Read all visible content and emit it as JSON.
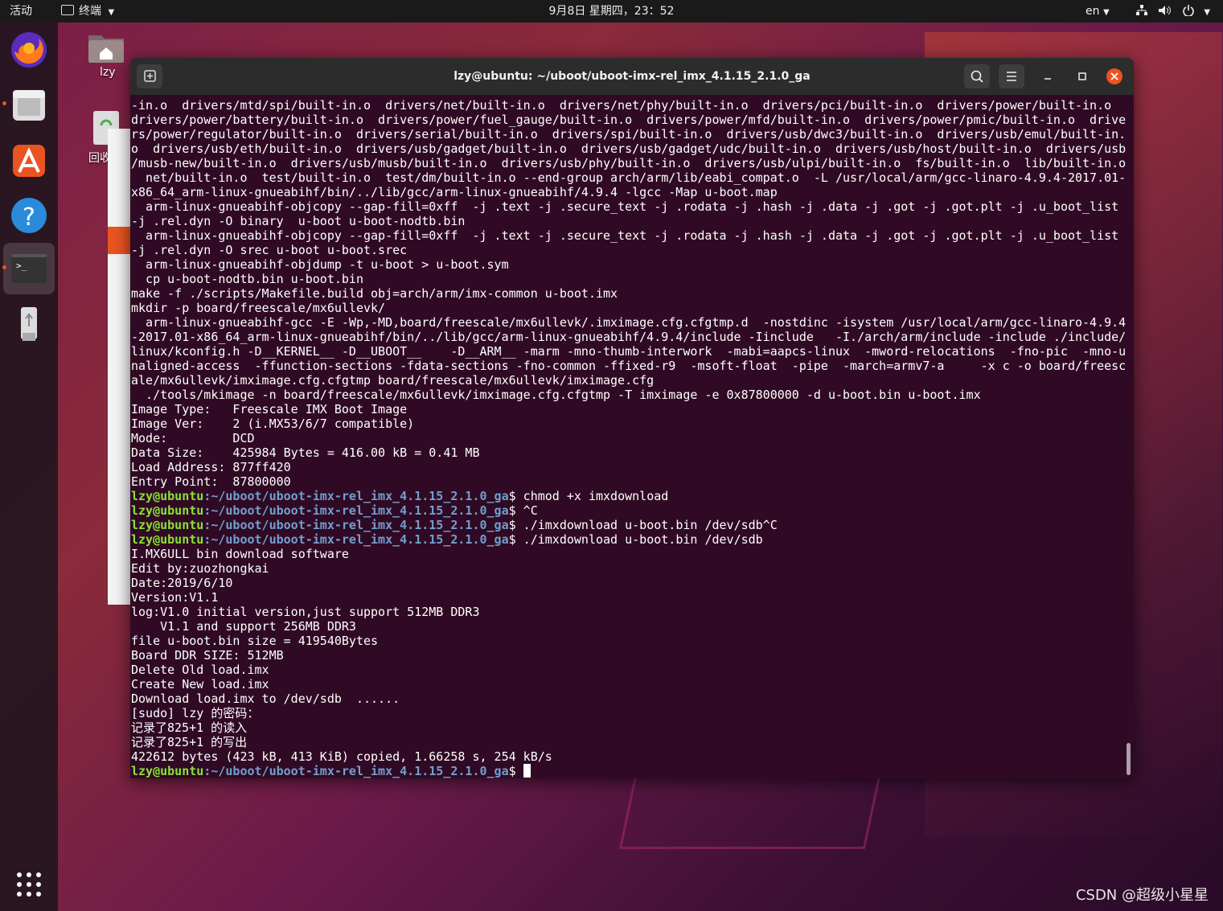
{
  "topbar": {
    "activities": "活动",
    "app_menu": "终端",
    "clock": "9月8日 星期四，23：52",
    "lang": "en"
  },
  "desktop": {
    "home_label": "lzy",
    "trash_label": "回收"
  },
  "terminal": {
    "title": "lzy@ubuntu: ~/uboot/uboot-imx-rel_imx_4.1.15_2.1.0_ga",
    "prompt_user": "lzy@ubuntu",
    "prompt_path": ":~/uboot/uboot-imx-rel_imx_4.1.15_2.1.0_ga",
    "lines_top": [
      "-in.o  drivers/mtd/spi/built-in.o  drivers/net/built-in.o  drivers/net/phy/built-in.o  drivers/pci/built-in.o  drivers/power/built-in.o",
      "drivers/power/battery/built-in.o  drivers/power/fuel_gauge/built-in.o  drivers/power/mfd/built-in.o  drivers/power/pmic/built-in.o  drive",
      "rs/power/regulator/built-in.o  drivers/serial/built-in.o  drivers/spi/built-in.o  drivers/usb/dwc3/built-in.o  drivers/usb/emul/built-in.",
      "o  drivers/usb/eth/built-in.o  drivers/usb/gadget/built-in.o  drivers/usb/gadget/udc/built-in.o  drivers/usb/host/built-in.o  drivers/usb",
      "/musb-new/built-in.o  drivers/usb/musb/built-in.o  drivers/usb/phy/built-in.o  drivers/usb/ulpi/built-in.o  fs/built-in.o  lib/built-in.o",
      "  net/built-in.o  test/built-in.o  test/dm/built-in.o --end-group arch/arm/lib/eabi_compat.o  -L /usr/local/arm/gcc-linaro-4.9.4-2017.01-",
      "x86_64_arm-linux-gnueabihf/bin/../lib/gcc/arm-linux-gnueabihf/4.9.4 -lgcc -Map u-boot.map",
      "  arm-linux-gnueabihf-objcopy --gap-fill=0xff  -j .text -j .secure_text -j .rodata -j .hash -j .data -j .got -j .got.plt -j .u_boot_list",
      "-j .rel.dyn -O binary  u-boot u-boot-nodtb.bin",
      "  arm-linux-gnueabihf-objcopy --gap-fill=0xff  -j .text -j .secure_text -j .rodata -j .hash -j .data -j .got -j .got.plt -j .u_boot_list",
      "-j .rel.dyn -O srec u-boot u-boot.srec",
      "  arm-linux-gnueabihf-objdump -t u-boot > u-boot.sym",
      "  cp u-boot-nodtb.bin u-boot.bin",
      "make -f ./scripts/Makefile.build obj=arch/arm/imx-common u-boot.imx",
      "mkdir -p board/freescale/mx6ullevk/",
      "  arm-linux-gnueabihf-gcc -E -Wp,-MD,board/freescale/mx6ullevk/.imximage.cfg.cfgtmp.d  -nostdinc -isystem /usr/local/arm/gcc-linaro-4.9.4",
      "-2017.01-x86_64_arm-linux-gnueabihf/bin/../lib/gcc/arm-linux-gnueabihf/4.9.4/include -Iinclude   -I./arch/arm/include -include ./include/",
      "linux/kconfig.h -D__KERNEL__ -D__UBOOT__    -D__ARM__ -marm -mno-thumb-interwork  -mabi=aapcs-linux  -mword-relocations  -fno-pic  -mno-u",
      "naligned-access  -ffunction-sections -fdata-sections -fno-common -ffixed-r9  -msoft-float  -pipe  -march=armv7-a     -x c -o board/freesc",
      "ale/mx6ullevk/imximage.cfg.cfgtmp board/freescale/mx6ullevk/imximage.cfg",
      "  ./tools/mkimage -n board/freescale/mx6ullevk/imximage.cfg.cfgtmp -T imximage -e 0x87800000 -d u-boot.bin u-boot.imx",
      "Image Type:   Freescale IMX Boot Image",
      "Image Ver:    2 (i.MX53/6/7 compatible)",
      "Mode:         DCD",
      "Data Size:    425984 Bytes = 416.00 kB = 0.41 MB",
      "Load Address: 877ff420",
      "Entry Point:  87800000"
    ],
    "commands": [
      "$ chmod +x imxdownload",
      "$ ^C",
      "$ ./imxdownload u-boot.bin /dev/sdb^C",
      "$ ./imxdownload u-boot.bin /dev/sdb"
    ],
    "lines_bottom": [
      "I.MX6ULL bin download software",
      "Edit by:zuozhongkai",
      "Date:2019/6/10",
      "Version:V1.1",
      "log:V1.0 initial version,just support 512MB DDR3",
      "    V1.1 and support 256MB DDR3",
      "file u-boot.bin size = 419540Bytes",
      "Board DDR SIZE: 512MB",
      "Delete Old load.imx",
      "Create New load.imx",
      "Download load.imx to /dev/sdb  ......",
      "[sudo] lzy 的密码：",
      "记录了825+1 的读入",
      "记录了825+1 的写出",
      "422612 bytes (423 kB, 413 KiB) copied, 1.66258 s, 254 kB/s"
    ],
    "final_prompt_suffix": "$ "
  },
  "watermark": "CSDN @超级小星星"
}
